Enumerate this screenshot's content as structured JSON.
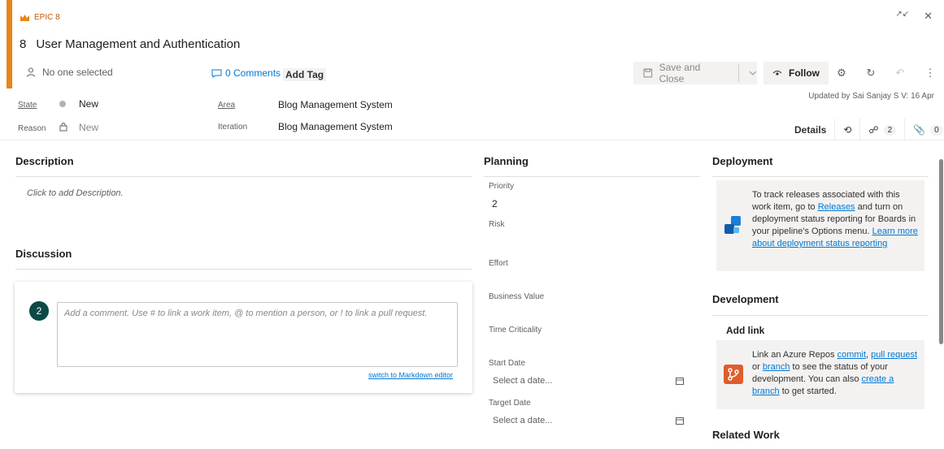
{
  "header": {
    "work_item_type": "EPIC 8",
    "id": "8",
    "title": "User Management and Authentication",
    "assignee": "No one selected",
    "comments_label": "0 Comments",
    "add_tag_label": "Add Tag",
    "accent_color": "#e8851a"
  },
  "toolbar": {
    "save_close_label": "Save and Close",
    "follow_label": "Follow",
    "updated_text": "Updated by Sai Sanjay S V: 16 Apr"
  },
  "fields": {
    "state_label": "State",
    "state_value": "New",
    "reason_label": "Reason",
    "reason_value": "New",
    "area_label": "Area",
    "area_value": "Blog Management System",
    "iteration_label": "Iteration",
    "iteration_value": "Blog Management System"
  },
  "tabs": {
    "details_label": "Details",
    "links_count": "2",
    "attachments_count": "0"
  },
  "description": {
    "title": "Description",
    "placeholder": "Click to add Description."
  },
  "discussion": {
    "title": "Discussion",
    "avatar_text": "2",
    "comment_placeholder": "Add a comment. Use # to link a work item, @ to mention a person, or ! to link a pull request.",
    "markdown_link": "switch to Markdown editor"
  },
  "planning": {
    "title": "Planning",
    "priority_label": "Priority",
    "priority_value": "2",
    "risk_label": "Risk",
    "effort_label": "Effort",
    "business_value_label": "Business Value",
    "time_criticality_label": "Time Criticality",
    "start_date_label": "Start Date",
    "start_date_placeholder": "Select a date...",
    "target_date_label": "Target Date",
    "target_date_placeholder": "Select a date..."
  },
  "deployment": {
    "title": "Deployment",
    "text_1": "To track releases associated with this work item, go to ",
    "releases_link": "Releases",
    "text_2": " and turn on deployment status reporting for Boards in your pipeline's Options menu. ",
    "learn_more_link": "Learn more about deployment status reporting"
  },
  "development": {
    "title": "Development",
    "add_link_label": "Add link",
    "text_1": "Link an Azure Repos ",
    "commit_link": "commit",
    "text_2": ", ",
    "pull_request_link": "pull request",
    "text_3": " or ",
    "branch_link": "branch",
    "text_4": " to see the status of your development. You can also ",
    "create_branch_link": "create a branch",
    "text_5": " to get started."
  },
  "related_work": {
    "title": "Related Work"
  },
  "icons": [
    "crown-icon",
    "minimize-icon",
    "close-icon",
    "person-icon",
    "comment-icon",
    "save-icon",
    "chevron-down-icon",
    "eye-icon",
    "settings-icon",
    "refresh-icon",
    "undo-icon",
    "more-icon",
    "state-dot-icon",
    "lock-icon",
    "history-icon",
    "link-icon",
    "attachment-icon",
    "calendar-icon",
    "rocket-icon",
    "git-icon"
  ]
}
